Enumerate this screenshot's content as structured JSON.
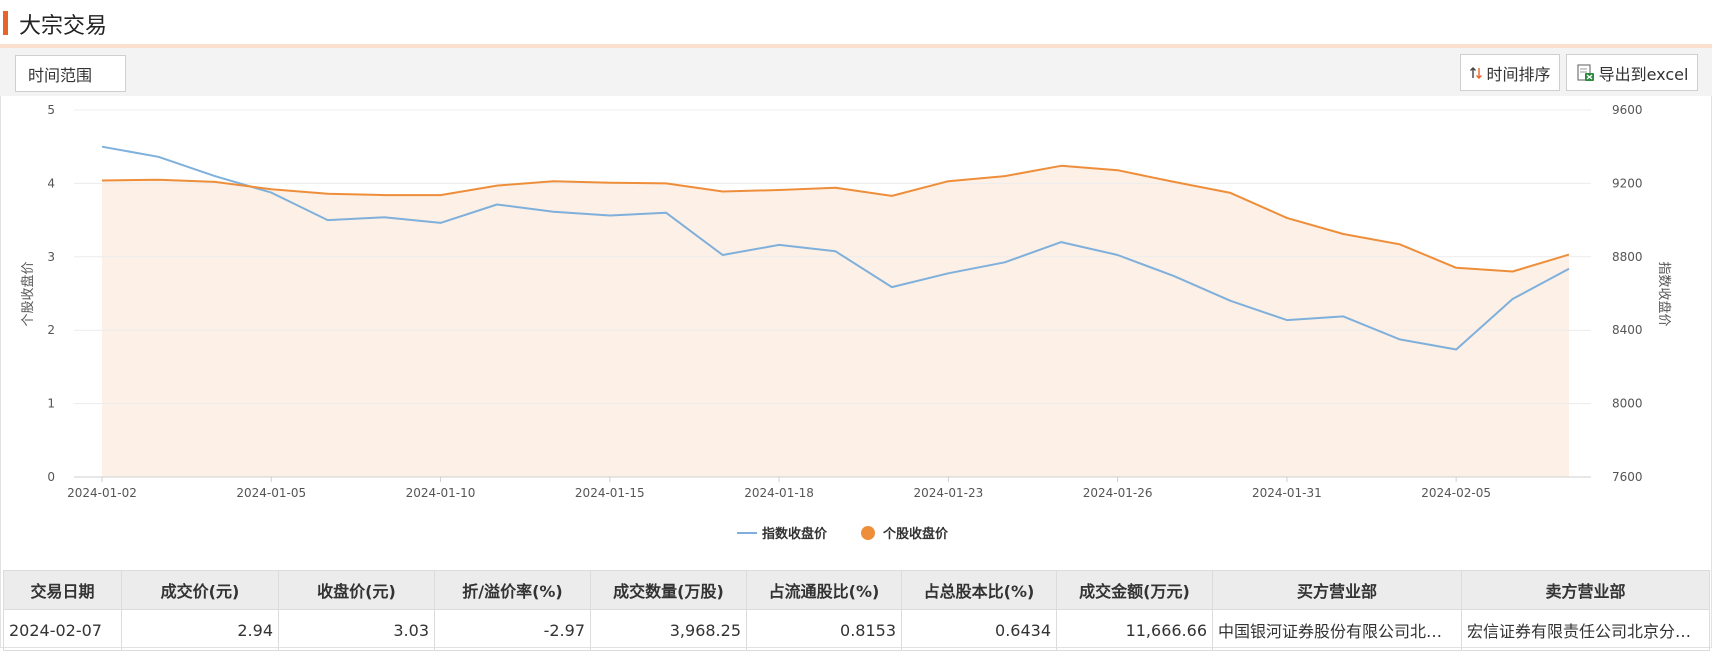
{
  "header": {
    "title": "大宗交易"
  },
  "toolbar": {
    "time_range_label": "时间范围",
    "sort_label": "时间排序",
    "export_label": "导出到excel"
  },
  "chart_data": {
    "type": "line",
    "x": [
      "2024-01-02",
      "2024-01-03",
      "2024-01-04",
      "2024-01-05",
      "2024-01-08",
      "2024-01-09",
      "2024-01-10",
      "2024-01-11",
      "2024-01-12",
      "2024-01-15",
      "2024-01-16",
      "2024-01-17",
      "2024-01-18",
      "2024-01-19",
      "2024-01-22",
      "2024-01-23",
      "2024-01-24",
      "2024-01-25",
      "2024-01-26",
      "2024-01-29",
      "2024-01-30",
      "2024-01-31",
      "2024-02-01",
      "2024-02-02",
      "2024-02-05",
      "2024-02-06",
      "2024-02-07"
    ],
    "x_tick_labels": [
      "2024-01-02",
      "2024-01-05",
      "2024-01-10",
      "2024-01-15",
      "2024-01-18",
      "2024-01-23",
      "2024-01-26",
      "2024-01-31",
      "2024-02-05"
    ],
    "series": [
      {
        "name": "指数收盘价",
        "axis": "right",
        "color": "#7fb0dc",
        "values": [
          9400,
          9345,
          9240,
          9150,
          9000,
          9015,
          8985,
          9085,
          9045,
          9025,
          9040,
          8810,
          8865,
          8830,
          8635,
          8710,
          8770,
          8880,
          8810,
          8695,
          8560,
          8455,
          8475,
          8350,
          8295,
          8570,
          8735
        ]
      },
      {
        "name": "个股收盘价",
        "axis": "left",
        "color": "#ee8e3a",
        "area_fill": "#fdf0e6",
        "values": [
          4.04,
          4.05,
          4.02,
          3.92,
          3.86,
          3.84,
          3.84,
          3.97,
          4.03,
          4.01,
          4.0,
          3.89,
          3.91,
          3.94,
          3.83,
          4.03,
          4.1,
          4.24,
          4.18,
          4.02,
          3.87,
          3.53,
          3.31,
          3.17,
          2.85,
          2.8,
          3.03
        ]
      }
    ],
    "y_left": {
      "label": "个股收盘价",
      "ticks": [
        "0",
        "1",
        "2",
        "3",
        "4",
        "5"
      ],
      "range": [
        0,
        5
      ]
    },
    "y_right": {
      "label": "指数收盘价",
      "ticks": [
        "7600",
        "8000",
        "8400",
        "8800",
        "9200",
        "9600"
      ],
      "range": [
        7600,
        9600
      ]
    },
    "legend_position": "bottom-center",
    "grid": true
  },
  "table": {
    "headers": [
      "交易日期",
      "成交价(元)",
      "收盘价(元)",
      "折/溢价率(%)",
      "成交数量(万股)",
      "占流通股比(%)",
      "占总股本比(%)",
      "成交金额(万元)",
      "买方营业部",
      "卖方营业部"
    ],
    "rows": [
      [
        "2024-02-07",
        "2.94",
        "3.03",
        "-2.97",
        "3,968.25",
        "0.8153",
        "0.6434",
        "11,666.66",
        "中国银河证券股份有限公司北京中关村大街证券营业部",
        "宏信证券有限责任公司北京分公司"
      ]
    ]
  }
}
